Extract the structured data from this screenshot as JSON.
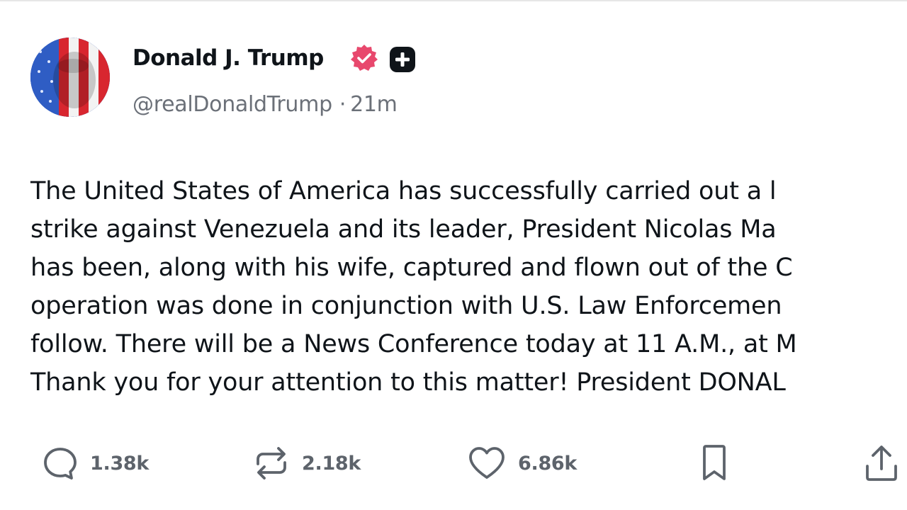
{
  "post": {
    "author": {
      "name": "Donald J. Trump",
      "handle": "@realDonaldTrump",
      "separator": "·",
      "time_ago": "21m"
    },
    "body_lines": [
      "The United States of America has successfully carried out a l",
      "strike against Venezuela and its leader, President Nicolas Ma",
      "has been, along with his wife, captured and flown out of the C",
      "operation was done in conjunction with U.S. Law Enforcemen",
      "follow. There will be a News Conference today at 11 A.M., at M",
      "Thank you for your attention to this matter! President DONAL"
    ],
    "actions": {
      "replies": "1.38k",
      "reposts": "2.18k",
      "likes": "6.86k"
    }
  },
  "icons": {
    "avatar": "flag-portrait-avatar",
    "verified": "verified-badge-icon",
    "plus_badge": "plus-badge-icon",
    "reply": "reply-icon",
    "repost": "repost-icon",
    "like": "heart-icon",
    "bookmark": "bookmark-icon",
    "share": "share-icon"
  },
  "colors": {
    "verified_badge": "#e8486d",
    "text_primary": "#0f1419",
    "text_secondary": "#6b7078",
    "action_gray": "#5d636b"
  }
}
